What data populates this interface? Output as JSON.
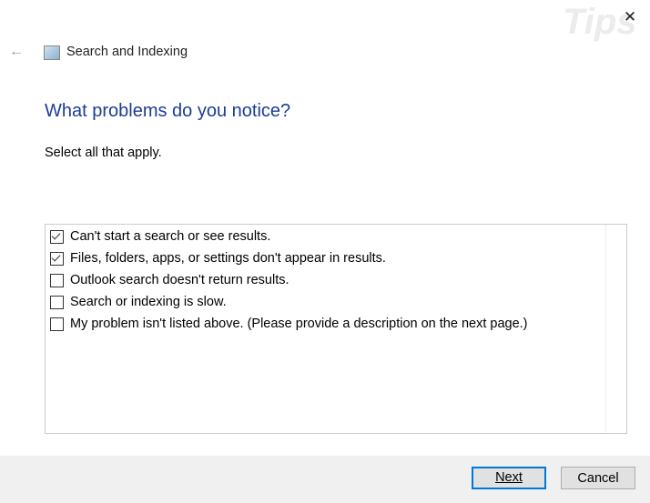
{
  "window": {
    "title": "Search and Indexing",
    "back_icon": "back-arrow-icon",
    "close_icon": "close-icon",
    "watermark": "Tips"
  },
  "page": {
    "heading": "What problems do you notice?",
    "instruction": "Select all that apply."
  },
  "options": [
    {
      "label": "Can't start a search or see results.",
      "checked": true
    },
    {
      "label": "Files, folders, apps, or settings don't appear in results.",
      "checked": true
    },
    {
      "label": "Outlook search doesn't return results.",
      "checked": false
    },
    {
      "label": "Search or indexing is slow.",
      "checked": false
    },
    {
      "label": "My problem isn't listed above. (Please provide a description on the next page.)",
      "checked": false
    }
  ],
  "buttons": {
    "next": "Next",
    "cancel": "Cancel"
  },
  "colors": {
    "heading": "#1c3c97",
    "accent": "#0078d7"
  }
}
